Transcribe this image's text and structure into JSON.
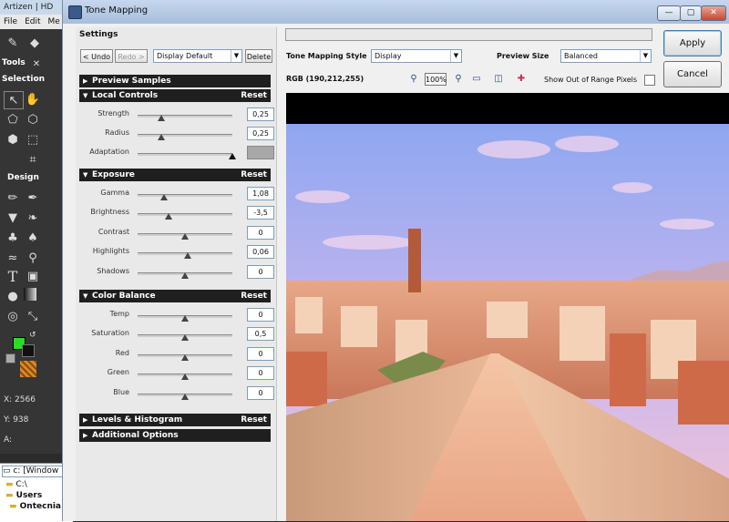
{
  "background_app": {
    "title": "Artizen | HD",
    "menu": [
      "File",
      "Edit",
      "Me"
    ],
    "tools_label": "Tools",
    "tools_close": "✕",
    "selection_label": "Selection",
    "design_label": "Design",
    "coord_x": "X: 2566",
    "coord_y": "Y: 938",
    "coord_a": "A:",
    "tree": [
      "c: [Window",
      "C:\\",
      "Users",
      "Ontecnia"
    ],
    "colors": {
      "foreground": "#22e022",
      "background": "#111111"
    }
  },
  "dialog": {
    "title": "Tone Mapping",
    "window_buttons": [
      "—",
      "▢",
      "✕"
    ]
  },
  "settings": {
    "group_label": "Settings",
    "undo_label": "< Undo",
    "redo_label": "Redo >",
    "preset_value": "Display Default",
    "delete_label": "Delete"
  },
  "sections": {
    "preview_samples": "Preview Samples",
    "local_controls": "Local Controls",
    "exposure": "Exposure",
    "color_balance": "Color Balance",
    "levels_histogram": "Levels & Histogram",
    "additional_options": "Additional Options",
    "reset": "Reset"
  },
  "local_controls": [
    {
      "label": "Strength",
      "value": "0,25",
      "level": 0.25
    },
    {
      "label": "Radius",
      "value": "0,25",
      "level": 0.25
    },
    {
      "label": "Adaptation",
      "value": "",
      "level": 1.0
    }
  ],
  "exposure": [
    {
      "label": "Gamma",
      "value": "1,08",
      "level": 0.28
    },
    {
      "label": "Brightness",
      "value": "-3,5",
      "level": 0.33
    },
    {
      "label": "Contrast",
      "value": "0",
      "level": 0.5
    },
    {
      "label": "Highlights",
      "value": "0,06",
      "level": 0.53
    },
    {
      "label": "Shadows",
      "value": "0",
      "level": 0.5
    }
  ],
  "color_balance": [
    {
      "label": "Temp",
      "value": "0",
      "level": 0.5
    },
    {
      "label": "Saturation",
      "value": "0,5",
      "level": 0.5
    },
    {
      "label": "Red",
      "value": "0",
      "level": 0.5
    },
    {
      "label": "Green",
      "value": "0",
      "level": 0.5
    },
    {
      "label": "Blue",
      "value": "0",
      "level": 0.5
    }
  ],
  "preview": {
    "style_label": "Tone Mapping Style",
    "style_value": "Display",
    "size_label": "Preview Size",
    "size_value": "Balanced",
    "rgb_readout": "RGB (190,212,255)",
    "zoom_value": "100%",
    "out_of_range_label": "Show Out of Range Pixels",
    "icons": [
      "zoom-in-icon",
      "zoom-out-icon",
      "compare-icon",
      "split-icon",
      "picker-icon"
    ]
  },
  "actions": {
    "apply_label": "Apply",
    "cancel_label": "Cancel"
  }
}
